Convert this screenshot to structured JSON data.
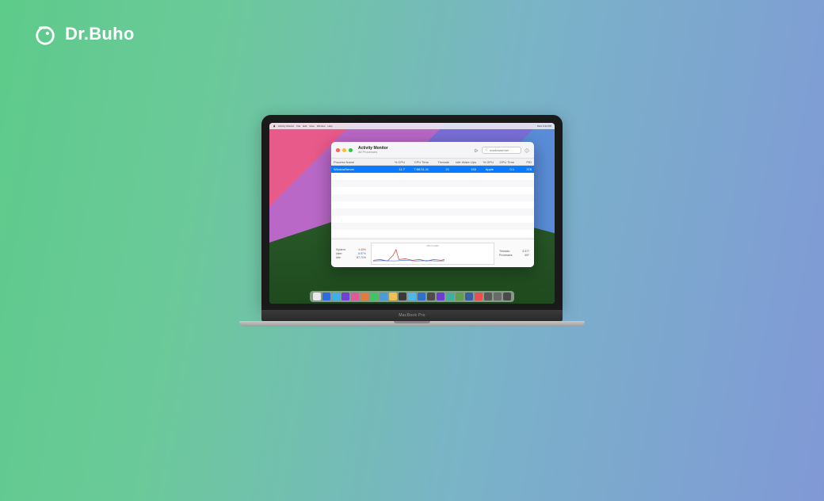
{
  "branding": {
    "name": "Dr.Buho"
  },
  "laptop": {
    "model": "MacBook Pro"
  },
  "menubar": {
    "apple": "",
    "items": [
      "Activity Monitor",
      "File",
      "Edit",
      "View",
      "Window",
      "Help"
    ],
    "right": [
      "Wed 3:42 PM"
    ]
  },
  "activity_monitor": {
    "title": "Activity Monitor",
    "subtitle": "All Processes",
    "search_placeholder": "windowserver",
    "columns": {
      "name": "Process Name",
      "cpu": "% CPU",
      "time": "CPU Time",
      "threads": "Threads",
      "wake": "Idle Wake Ups",
      "gpu": "% GPU",
      "gput": "GPU Time",
      "pid": "PID"
    },
    "selected_row": {
      "name": "WindowServer",
      "cpu": "11.7",
      "time": "7:58:31.11",
      "threads": "21",
      "wake": "153",
      "gpu": "Apple",
      "gput": "0.1",
      "pid": "378"
    },
    "footer": {
      "chart_label": "CPU LOAD",
      "left": {
        "system_label": "System:",
        "system_value": "3.45%",
        "user_label": "User:",
        "user_value": "8.87%",
        "idle_label": "Idle:",
        "idle_value": "87.71%"
      },
      "right": {
        "threads_label": "Threads:",
        "threads_value": "3,377",
        "processes_label": "Processes:",
        "processes_value": "497"
      }
    }
  },
  "dock": {
    "colors": [
      "#e8e8ea",
      "#2a6de0",
      "#3db0e8",
      "#6f3fd8",
      "#e05a9a",
      "#e07c3f",
      "#40c463",
      "#4a9bd8",
      "#f0c050",
      "#3a3a3a",
      "#50b8e8",
      "#2f6fd0",
      "#4c4c4c",
      "#6a3fd0",
      "#3fb0a0",
      "#609f50",
      "#3a5fa0",
      "#e85050",
      "#5a5a5a",
      "#6a6a6a",
      "#4a4a4a"
    ]
  }
}
